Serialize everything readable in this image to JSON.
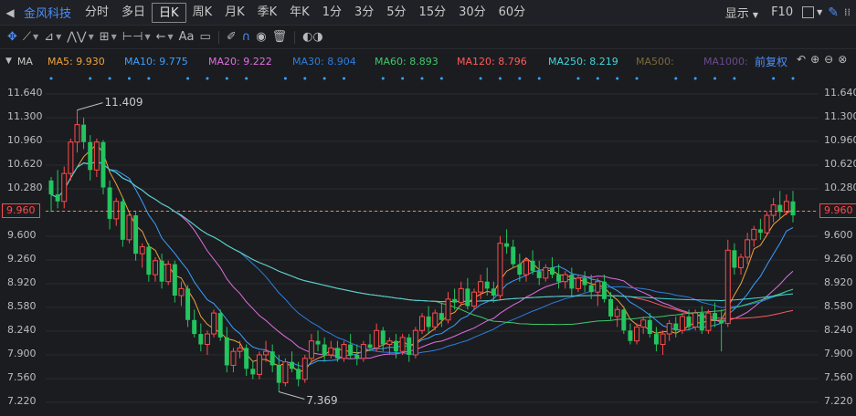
{
  "topbar": {
    "stock_name": "金风科技",
    "periods": [
      "分时",
      "多日",
      "日K",
      "周K",
      "月K",
      "季K",
      "年K",
      "1分",
      "3分",
      "5分",
      "15分",
      "30分",
      "60分"
    ],
    "active_period": "日K",
    "display_label": "显示",
    "f10_label": "F10"
  },
  "tools": {
    "text_tool": "Aa"
  },
  "ma_bar": {
    "label": "MA",
    "items": [
      {
        "text": "MA5: 9.930",
        "color": "#f0a23a"
      },
      {
        "text": "MA10: 9.775",
        "color": "#3aa0ff"
      },
      {
        "text": "MA20: 9.222",
        "color": "#e06ee0"
      },
      {
        "text": "MA30: 8.904",
        "color": "#2b7fe0"
      },
      {
        "text": "MA60: 8.893",
        "color": "#3ec96a"
      },
      {
        "text": "MA120: 8.796",
        "color": "#ff5a5a"
      },
      {
        "text": "MA250: 8.219",
        "color": "#3fd8d8"
      },
      {
        "text": "MA500:",
        "color": "#7a6a3a"
      },
      {
        "text": "MA1000:",
        "color": "#6a4a8a"
      }
    ],
    "restore_label": "前复权"
  },
  "chart": {
    "y_ticks": [
      "11.640",
      "11.300",
      "10.960",
      "10.620",
      "10.280",
      "9.960",
      "9.600",
      "9.260",
      "8.920",
      "8.580",
      "8.240",
      "7.900",
      "7.560",
      "7.220"
    ],
    "last_price": "9.960",
    "high_label": "11.409",
    "low_label": "7.369",
    "colors": {
      "up": "#ff4b4b",
      "down": "#22c55e",
      "bg": "#1b1c20",
      "grid": "#2a2b30",
      "last_line": "#ff8a3a"
    }
  },
  "chart_data": {
    "type": "candlestick",
    "ylim": [
      7.22,
      11.64
    ],
    "candles": [
      [
        10.4,
        10.45,
        9.95,
        10.2
      ],
      [
        10.2,
        10.55,
        10.0,
        10.1
      ],
      [
        10.1,
        10.6,
        10.0,
        10.5
      ],
      [
        10.5,
        11.0,
        10.4,
        10.95
      ],
      [
        10.95,
        11.41,
        10.8,
        11.2
      ],
      [
        11.2,
        11.3,
        10.85,
        10.95
      ],
      [
        10.95,
        11.05,
        10.4,
        10.55
      ],
      [
        10.55,
        11.0,
        10.45,
        10.95
      ],
      [
        10.95,
        10.98,
        10.2,
        10.3
      ],
      [
        10.3,
        10.4,
        9.7,
        9.85
      ],
      [
        9.85,
        10.15,
        9.75,
        10.1
      ],
      [
        10.1,
        10.15,
        9.45,
        9.55
      ],
      [
        9.55,
        9.95,
        9.5,
        9.9
      ],
      [
        9.9,
        9.95,
        9.25,
        9.35
      ],
      [
        9.35,
        9.5,
        9.15,
        9.45
      ],
      [
        9.45,
        9.5,
        8.95,
        9.05
      ],
      [
        9.05,
        9.3,
        8.95,
        9.25
      ],
      [
        9.25,
        9.35,
        8.85,
        8.95
      ],
      [
        8.95,
        9.25,
        8.9,
        9.2
      ],
      [
        9.2,
        9.25,
        8.65,
        8.75
      ],
      [
        8.75,
        8.95,
        8.6,
        8.85
      ],
      [
        8.85,
        8.9,
        8.3,
        8.4
      ],
      [
        8.4,
        8.55,
        8.15,
        8.2
      ],
      [
        8.2,
        8.35,
        7.95,
        8.05
      ],
      [
        8.05,
        8.25,
        7.9,
        8.2
      ],
      [
        8.2,
        8.55,
        8.15,
        8.5
      ],
      [
        8.5,
        8.55,
        8.1,
        8.15
      ],
      [
        8.15,
        8.3,
        7.65,
        7.75
      ],
      [
        7.75,
        8.0,
        7.65,
        7.95
      ],
      [
        7.95,
        8.1,
        7.85,
        8.0
      ],
      [
        8.0,
        8.05,
        7.6,
        7.7
      ],
      [
        7.7,
        7.8,
        7.55,
        7.62
      ],
      [
        7.62,
        7.95,
        7.55,
        7.9
      ],
      [
        7.9,
        8.1,
        7.8,
        7.95
      ],
      [
        7.95,
        8.05,
        7.65,
        7.75
      ],
      [
        7.75,
        7.9,
        7.37,
        7.5
      ],
      [
        7.5,
        7.85,
        7.45,
        7.8
      ],
      [
        7.8,
        7.95,
        7.65,
        7.7
      ],
      [
        7.7,
        7.8,
        7.45,
        7.55
      ],
      [
        7.55,
        7.9,
        7.5,
        7.85
      ],
      [
        7.85,
        8.2,
        7.8,
        8.1
      ],
      [
        8.1,
        8.25,
        7.95,
        8.05
      ],
      [
        8.05,
        8.15,
        7.8,
        7.9
      ],
      [
        7.9,
        8.1,
        7.85,
        8.0
      ],
      [
        8.0,
        8.1,
        7.8,
        7.85
      ],
      [
        7.85,
        8.1,
        7.8,
        8.05
      ],
      [
        8.05,
        8.2,
        7.85,
        7.9
      ],
      [
        7.9,
        8.05,
        7.75,
        7.85
      ],
      [
        7.85,
        8.1,
        7.8,
        8.05
      ],
      [
        8.05,
        8.2,
        7.95,
        8.0
      ],
      [
        8.0,
        8.35,
        7.95,
        8.25
      ],
      [
        8.25,
        8.3,
        7.95,
        8.05
      ],
      [
        8.05,
        8.15,
        7.9,
        8.1
      ],
      [
        8.1,
        8.2,
        7.85,
        7.95
      ],
      [
        7.95,
        8.2,
        7.9,
        8.15
      ],
      [
        8.15,
        8.2,
        7.8,
        7.9
      ],
      [
        7.9,
        8.3,
        7.85,
        8.25
      ],
      [
        8.25,
        8.5,
        8.2,
        8.45
      ],
      [
        8.45,
        8.6,
        8.2,
        8.3
      ],
      [
        8.3,
        8.55,
        8.25,
        8.5
      ],
      [
        8.5,
        8.65,
        8.3,
        8.4
      ],
      [
        8.4,
        8.8,
        8.35,
        8.7
      ],
      [
        8.7,
        8.85,
        8.55,
        8.65
      ],
      [
        8.65,
        8.95,
        8.6,
        8.85
      ],
      [
        8.85,
        9.0,
        8.55,
        8.6
      ],
      [
        8.6,
        8.85,
        8.55,
        8.8
      ],
      [
        8.8,
        9.05,
        8.7,
        8.95
      ],
      [
        8.95,
        9.15,
        8.75,
        8.85
      ],
      [
        8.85,
        8.95,
        8.65,
        8.75
      ],
      [
        8.75,
        9.6,
        8.7,
        9.5
      ],
      [
        9.5,
        9.7,
        9.35,
        9.45
      ],
      [
        9.45,
        9.55,
        9.15,
        9.2
      ],
      [
        9.2,
        9.35,
        8.95,
        9.05
      ],
      [
        9.05,
        9.3,
        8.95,
        9.25
      ],
      [
        9.25,
        9.4,
        9.05,
        9.1
      ],
      [
        9.1,
        9.25,
        8.9,
        9.0
      ],
      [
        9.0,
        9.2,
        8.95,
        9.15
      ],
      [
        9.15,
        9.3,
        9.0,
        9.05
      ],
      [
        9.05,
        9.2,
        8.85,
        8.95
      ],
      [
        8.95,
        9.1,
        8.85,
        9.05
      ],
      [
        9.05,
        9.15,
        8.75,
        8.85
      ],
      [
        8.85,
        9.05,
        8.8,
        9.0
      ],
      [
        9.0,
        9.1,
        8.8,
        8.9
      ],
      [
        8.9,
        9.05,
        8.7,
        8.8
      ],
      [
        8.8,
        9.0,
        8.6,
        8.95
      ],
      [
        8.95,
        9.05,
        8.65,
        8.7
      ],
      [
        8.7,
        8.8,
        8.4,
        8.45
      ],
      [
        8.45,
        8.6,
        8.3,
        8.55
      ],
      [
        8.55,
        8.6,
        8.2,
        8.25
      ],
      [
        8.25,
        8.35,
        8.05,
        8.1
      ],
      [
        8.1,
        8.35,
        8.05,
        8.3
      ],
      [
        8.3,
        8.45,
        8.2,
        8.4
      ],
      [
        8.4,
        8.5,
        8.15,
        8.2
      ],
      [
        8.2,
        8.3,
        7.95,
        8.05
      ],
      [
        8.05,
        8.25,
        7.9,
        8.2
      ],
      [
        8.2,
        8.4,
        8.1,
        8.35
      ],
      [
        8.35,
        8.45,
        8.15,
        8.25
      ],
      [
        8.25,
        8.5,
        8.2,
        8.45
      ],
      [
        8.45,
        8.55,
        8.25,
        8.3
      ],
      [
        8.3,
        8.55,
        8.25,
        8.5
      ],
      [
        8.5,
        8.6,
        8.2,
        8.25
      ],
      [
        8.25,
        8.55,
        8.2,
        8.5
      ],
      [
        8.5,
        8.65,
        8.3,
        8.4
      ],
      [
        8.4,
        8.55,
        7.95,
        8.35
      ],
      [
        8.35,
        9.55,
        8.3,
        9.4
      ],
      [
        9.4,
        9.5,
        9.05,
        9.15
      ],
      [
        9.15,
        9.35,
        9.05,
        9.3
      ],
      [
        9.3,
        9.65,
        9.2,
        9.55
      ],
      [
        9.55,
        9.75,
        9.45,
        9.7
      ],
      [
        9.7,
        9.85,
        9.55,
        9.65
      ],
      [
        9.65,
        9.95,
        9.6,
        9.9
      ],
      [
        9.9,
        10.15,
        9.8,
        10.05
      ],
      [
        10.05,
        10.25,
        9.85,
        9.95
      ],
      [
        9.95,
        10.2,
        9.9,
        10.1
      ],
      [
        10.1,
        10.25,
        9.8,
        9.9
      ]
    ]
  }
}
